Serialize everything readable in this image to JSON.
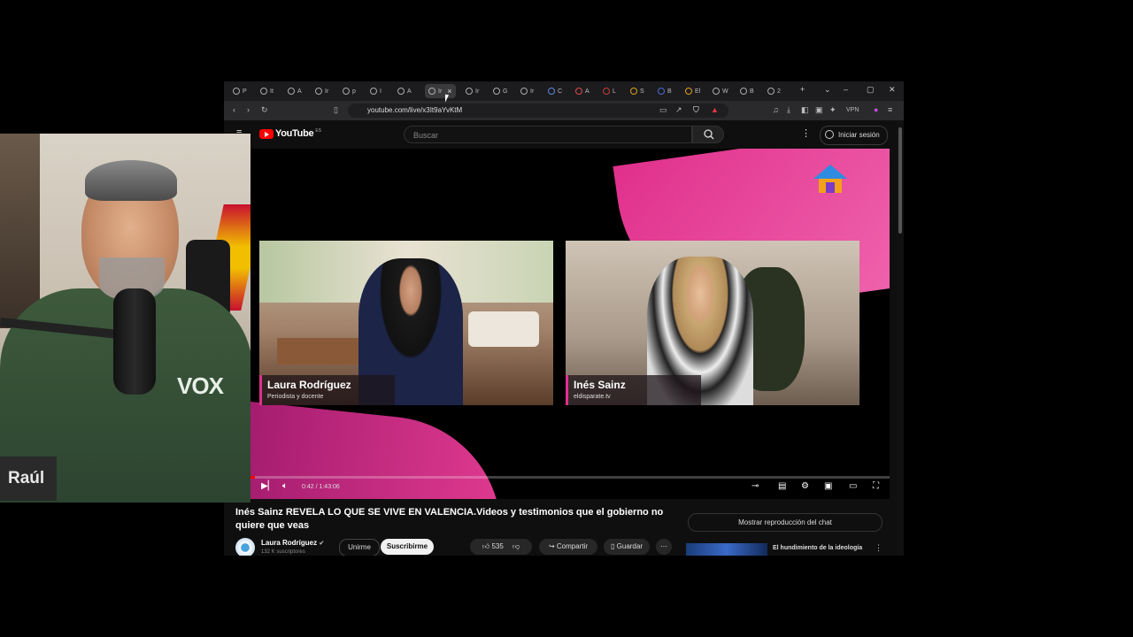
{
  "browser": {
    "tabs": [
      {
        "label": "P"
      },
      {
        "label": "It"
      },
      {
        "label": "A"
      },
      {
        "label": "Ir"
      },
      {
        "label": "p"
      },
      {
        "label": "I"
      },
      {
        "label": "A"
      },
      {
        "label": "Ir",
        "active": true
      },
      {
        "label": "Ir"
      },
      {
        "label": "G"
      },
      {
        "label": "Ir"
      },
      {
        "label": "C"
      },
      {
        "label": "A"
      },
      {
        "label": "L"
      },
      {
        "label": "S"
      },
      {
        "label": "B"
      },
      {
        "label": "El"
      },
      {
        "label": "W"
      },
      {
        "label": "B"
      },
      {
        "label": "2"
      }
    ],
    "new_tab": "+",
    "url": "youtube.com/live/x3It9aYvKtM",
    "vpn_label": "VPN"
  },
  "youtube": {
    "logo_text": "YouTube",
    "logo_country": "ES",
    "search_placeholder": "Buscar",
    "signin_label": "Iniciar sesión",
    "video": {
      "guest1_name": "Laura Rodríguez",
      "guest1_role": "Periodista y docente",
      "guest2_name": "Inés Sainz",
      "guest2_role": "eldisparate.tv",
      "time_current": "0:42",
      "time_total": "1:43:06",
      "progress_fraction": 0.007
    },
    "title": "Inés Sainz REVELA LO QUE SE VIVE EN VALENCIA.Videos y testimonios que el gobierno no quiere que veas",
    "channel_name": "Laura Rodríguez",
    "channel_subs": "132 K suscriptores",
    "join_label": "Unirme",
    "subscribe_label": "Suscribirme",
    "likes": "535",
    "share_label": "Compartir",
    "save_label": "Guardar",
    "chat_button": "Mostrar reproducción del chat",
    "recommended_title": "El hundimiento de la ideología"
  },
  "webcam": {
    "shirt_logo": "VOX",
    "name_tag": "Raúl"
  },
  "colors": {
    "accent_pink": "#e0308c",
    "youtube_red": "#ff0000"
  }
}
